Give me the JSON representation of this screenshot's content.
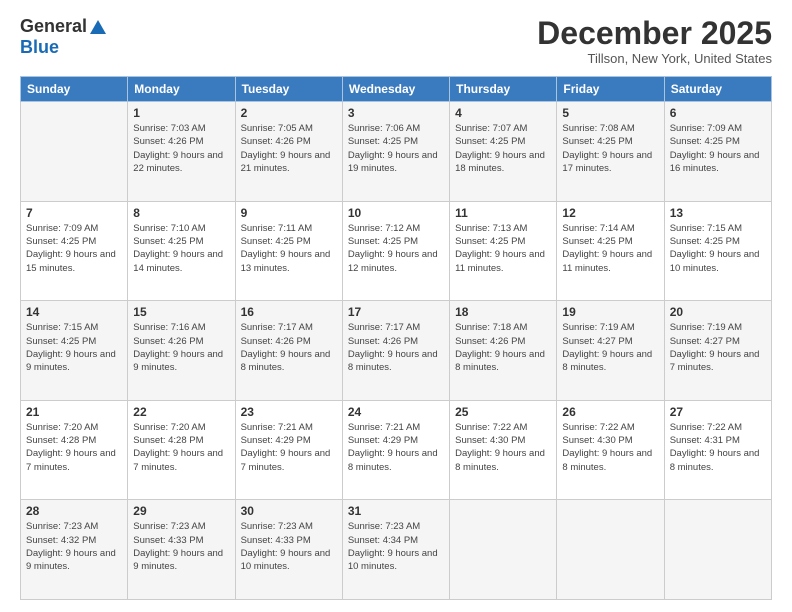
{
  "header": {
    "logo_general": "General",
    "logo_blue": "Blue",
    "month_title": "December 2025",
    "location": "Tillson, New York, United States"
  },
  "days_of_week": [
    "Sunday",
    "Monday",
    "Tuesday",
    "Wednesday",
    "Thursday",
    "Friday",
    "Saturday"
  ],
  "weeks": [
    [
      {
        "day": "",
        "sunrise": "",
        "sunset": "",
        "daylight": ""
      },
      {
        "day": "1",
        "sunrise": "Sunrise: 7:03 AM",
        "sunset": "Sunset: 4:26 PM",
        "daylight": "Daylight: 9 hours and 22 minutes."
      },
      {
        "day": "2",
        "sunrise": "Sunrise: 7:05 AM",
        "sunset": "Sunset: 4:26 PM",
        "daylight": "Daylight: 9 hours and 21 minutes."
      },
      {
        "day": "3",
        "sunrise": "Sunrise: 7:06 AM",
        "sunset": "Sunset: 4:25 PM",
        "daylight": "Daylight: 9 hours and 19 minutes."
      },
      {
        "day": "4",
        "sunrise": "Sunrise: 7:07 AM",
        "sunset": "Sunset: 4:25 PM",
        "daylight": "Daylight: 9 hours and 18 minutes."
      },
      {
        "day": "5",
        "sunrise": "Sunrise: 7:08 AM",
        "sunset": "Sunset: 4:25 PM",
        "daylight": "Daylight: 9 hours and 17 minutes."
      },
      {
        "day": "6",
        "sunrise": "Sunrise: 7:09 AM",
        "sunset": "Sunset: 4:25 PM",
        "daylight": "Daylight: 9 hours and 16 minutes."
      }
    ],
    [
      {
        "day": "7",
        "sunrise": "Sunrise: 7:09 AM",
        "sunset": "Sunset: 4:25 PM",
        "daylight": "Daylight: 9 hours and 15 minutes."
      },
      {
        "day": "8",
        "sunrise": "Sunrise: 7:10 AM",
        "sunset": "Sunset: 4:25 PM",
        "daylight": "Daylight: 9 hours and 14 minutes."
      },
      {
        "day": "9",
        "sunrise": "Sunrise: 7:11 AM",
        "sunset": "Sunset: 4:25 PM",
        "daylight": "Daylight: 9 hours and 13 minutes."
      },
      {
        "day": "10",
        "sunrise": "Sunrise: 7:12 AM",
        "sunset": "Sunset: 4:25 PM",
        "daylight": "Daylight: 9 hours and 12 minutes."
      },
      {
        "day": "11",
        "sunrise": "Sunrise: 7:13 AM",
        "sunset": "Sunset: 4:25 PM",
        "daylight": "Daylight: 9 hours and 11 minutes."
      },
      {
        "day": "12",
        "sunrise": "Sunrise: 7:14 AM",
        "sunset": "Sunset: 4:25 PM",
        "daylight": "Daylight: 9 hours and 11 minutes."
      },
      {
        "day": "13",
        "sunrise": "Sunrise: 7:15 AM",
        "sunset": "Sunset: 4:25 PM",
        "daylight": "Daylight: 9 hours and 10 minutes."
      }
    ],
    [
      {
        "day": "14",
        "sunrise": "Sunrise: 7:15 AM",
        "sunset": "Sunset: 4:25 PM",
        "daylight": "Daylight: 9 hours and 9 minutes."
      },
      {
        "day": "15",
        "sunrise": "Sunrise: 7:16 AM",
        "sunset": "Sunset: 4:26 PM",
        "daylight": "Daylight: 9 hours and 9 minutes."
      },
      {
        "day": "16",
        "sunrise": "Sunrise: 7:17 AM",
        "sunset": "Sunset: 4:26 PM",
        "daylight": "Daylight: 9 hours and 8 minutes."
      },
      {
        "day": "17",
        "sunrise": "Sunrise: 7:17 AM",
        "sunset": "Sunset: 4:26 PM",
        "daylight": "Daylight: 9 hours and 8 minutes."
      },
      {
        "day": "18",
        "sunrise": "Sunrise: 7:18 AM",
        "sunset": "Sunset: 4:26 PM",
        "daylight": "Daylight: 9 hours and 8 minutes."
      },
      {
        "day": "19",
        "sunrise": "Sunrise: 7:19 AM",
        "sunset": "Sunset: 4:27 PM",
        "daylight": "Daylight: 9 hours and 8 minutes."
      },
      {
        "day": "20",
        "sunrise": "Sunrise: 7:19 AM",
        "sunset": "Sunset: 4:27 PM",
        "daylight": "Daylight: 9 hours and 7 minutes."
      }
    ],
    [
      {
        "day": "21",
        "sunrise": "Sunrise: 7:20 AM",
        "sunset": "Sunset: 4:28 PM",
        "daylight": "Daylight: 9 hours and 7 minutes."
      },
      {
        "day": "22",
        "sunrise": "Sunrise: 7:20 AM",
        "sunset": "Sunset: 4:28 PM",
        "daylight": "Daylight: 9 hours and 7 minutes."
      },
      {
        "day": "23",
        "sunrise": "Sunrise: 7:21 AM",
        "sunset": "Sunset: 4:29 PM",
        "daylight": "Daylight: 9 hours and 7 minutes."
      },
      {
        "day": "24",
        "sunrise": "Sunrise: 7:21 AM",
        "sunset": "Sunset: 4:29 PM",
        "daylight": "Daylight: 9 hours and 8 minutes."
      },
      {
        "day": "25",
        "sunrise": "Sunrise: 7:22 AM",
        "sunset": "Sunset: 4:30 PM",
        "daylight": "Daylight: 9 hours and 8 minutes."
      },
      {
        "day": "26",
        "sunrise": "Sunrise: 7:22 AM",
        "sunset": "Sunset: 4:30 PM",
        "daylight": "Daylight: 9 hours and 8 minutes."
      },
      {
        "day": "27",
        "sunrise": "Sunrise: 7:22 AM",
        "sunset": "Sunset: 4:31 PM",
        "daylight": "Daylight: 9 hours and 8 minutes."
      }
    ],
    [
      {
        "day": "28",
        "sunrise": "Sunrise: 7:23 AM",
        "sunset": "Sunset: 4:32 PM",
        "daylight": "Daylight: 9 hours and 9 minutes."
      },
      {
        "day": "29",
        "sunrise": "Sunrise: 7:23 AM",
        "sunset": "Sunset: 4:33 PM",
        "daylight": "Daylight: 9 hours and 9 minutes."
      },
      {
        "day": "30",
        "sunrise": "Sunrise: 7:23 AM",
        "sunset": "Sunset: 4:33 PM",
        "daylight": "Daylight: 9 hours and 10 minutes."
      },
      {
        "day": "31",
        "sunrise": "Sunrise: 7:23 AM",
        "sunset": "Sunset: 4:34 PM",
        "daylight": "Daylight: 9 hours and 10 minutes."
      },
      {
        "day": "",
        "sunrise": "",
        "sunset": "",
        "daylight": ""
      },
      {
        "day": "",
        "sunrise": "",
        "sunset": "",
        "daylight": ""
      },
      {
        "day": "",
        "sunrise": "",
        "sunset": "",
        "daylight": ""
      }
    ]
  ]
}
